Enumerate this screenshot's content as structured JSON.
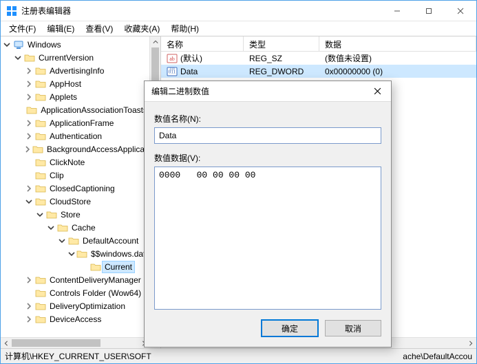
{
  "window": {
    "title": "注册表编辑器"
  },
  "menu": {
    "file": "文件(F)",
    "edit": "编辑(E)",
    "view": "查看(V)",
    "favorites": "收藏夹(A)",
    "help": "帮助(H)"
  },
  "columns": {
    "name": "名称",
    "type": "类型",
    "data": "数据"
  },
  "values": [
    {
      "icon": "sz",
      "name": "(默认)",
      "type": "REG_SZ",
      "data": "(数值未设置)",
      "selected": false
    },
    {
      "icon": "dword",
      "name": "Data",
      "type": "REG_DWORD",
      "data": "0x00000000 (0)",
      "selected": true
    }
  ],
  "tree": [
    {
      "depth": 0,
      "exp": "open",
      "kind": "computer",
      "label": "Windows"
    },
    {
      "depth": 1,
      "exp": "open",
      "kind": "folder",
      "label": "CurrentVersion"
    },
    {
      "depth": 2,
      "exp": "closed",
      "kind": "folder",
      "label": "AdvertisingInfo"
    },
    {
      "depth": 2,
      "exp": "closed",
      "kind": "folder",
      "label": "AppHost"
    },
    {
      "depth": 2,
      "exp": "closed",
      "kind": "folder",
      "label": "Applets"
    },
    {
      "depth": 2,
      "exp": "none",
      "kind": "folder",
      "label": "ApplicationAssociationToasts"
    },
    {
      "depth": 2,
      "exp": "closed",
      "kind": "folder",
      "label": "ApplicationFrame"
    },
    {
      "depth": 2,
      "exp": "closed",
      "kind": "folder",
      "label": "Authentication"
    },
    {
      "depth": 2,
      "exp": "closed",
      "kind": "folder",
      "label": "BackgroundAccessApplications"
    },
    {
      "depth": 2,
      "exp": "none",
      "kind": "folder",
      "label": "ClickNote"
    },
    {
      "depth": 2,
      "exp": "none",
      "kind": "folder",
      "label": "Clip"
    },
    {
      "depth": 2,
      "exp": "closed",
      "kind": "folder",
      "label": "ClosedCaptioning"
    },
    {
      "depth": 2,
      "exp": "open",
      "kind": "folder",
      "label": "CloudStore"
    },
    {
      "depth": 3,
      "exp": "open",
      "kind": "folder",
      "label": "Store"
    },
    {
      "depth": 4,
      "exp": "open",
      "kind": "folder",
      "label": "Cache"
    },
    {
      "depth": 5,
      "exp": "open",
      "kind": "folder",
      "label": "DefaultAccount"
    },
    {
      "depth": 6,
      "exp": "open",
      "kind": "folder",
      "label": "$$windows.data"
    },
    {
      "depth": 7,
      "exp": "none",
      "kind": "folder",
      "label": "Current",
      "selected": true
    },
    {
      "depth": 2,
      "exp": "closed",
      "kind": "folder",
      "label": "ContentDeliveryManager"
    },
    {
      "depth": 2,
      "exp": "none",
      "kind": "folder",
      "label": "Controls Folder (Wow64)"
    },
    {
      "depth": 2,
      "exp": "closed",
      "kind": "folder",
      "label": "DeliveryOptimization"
    },
    {
      "depth": 2,
      "exp": "closed",
      "kind": "folder",
      "label": "DeviceAccess"
    }
  ],
  "status": {
    "left": "计算机\\HKEY_CURRENT_USER\\SOFT",
    "right": "ache\\DefaultAccou"
  },
  "dialog": {
    "title": "编辑二进制数值",
    "name_label": "数值名称(N):",
    "name_value": "Data",
    "data_label": "数值数据(V):",
    "hex": "0000   00 00 00 00                          ....",
    "ok": "确定",
    "cancel": "取消"
  }
}
